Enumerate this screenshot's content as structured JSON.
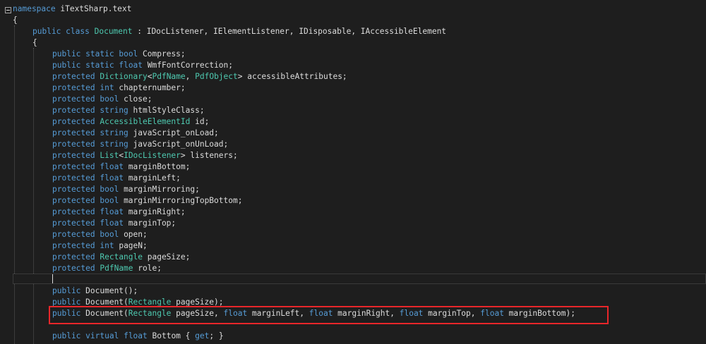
{
  "editor": {
    "lines": [
      [
        {
          "t": "namespace",
          "c": "kw"
        },
        {
          "t": " iTextSharp.text",
          "c": "id"
        }
      ],
      [
        {
          "t": "{",
          "c": "id"
        }
      ],
      [
        {
          "t": "public",
          "c": "kw"
        },
        {
          "t": " ",
          "c": "id"
        },
        {
          "t": "class",
          "c": "kw"
        },
        {
          "t": " ",
          "c": "id"
        },
        {
          "t": "Document",
          "c": "ty"
        },
        {
          "t": " : IDocListener, IElementListener, IDisposable, IAccessibleElement",
          "c": "id"
        }
      ],
      [
        {
          "t": "{",
          "c": "id"
        }
      ],
      [
        {
          "t": "public",
          "c": "kw"
        },
        {
          "t": " ",
          "c": "id"
        },
        {
          "t": "static",
          "c": "kw"
        },
        {
          "t": " ",
          "c": "id"
        },
        {
          "t": "bool",
          "c": "kw"
        },
        {
          "t": " Compress;",
          "c": "id"
        }
      ],
      [
        {
          "t": "public",
          "c": "kw"
        },
        {
          "t": " ",
          "c": "id"
        },
        {
          "t": "static",
          "c": "kw"
        },
        {
          "t": " ",
          "c": "id"
        },
        {
          "t": "float",
          "c": "kw"
        },
        {
          "t": " WmfFontCorrection;",
          "c": "id"
        }
      ],
      [
        {
          "t": "protected",
          "c": "kw"
        },
        {
          "t": " ",
          "c": "id"
        },
        {
          "t": "Dictionary",
          "c": "ty"
        },
        {
          "t": "<",
          "c": "id"
        },
        {
          "t": "PdfName",
          "c": "ty"
        },
        {
          "t": ", ",
          "c": "id"
        },
        {
          "t": "PdfObject",
          "c": "ty"
        },
        {
          "t": "> accessibleAttributes;",
          "c": "id"
        }
      ],
      [
        {
          "t": "protected",
          "c": "kw"
        },
        {
          "t": " ",
          "c": "id"
        },
        {
          "t": "int",
          "c": "kw"
        },
        {
          "t": " chapternumber;",
          "c": "id"
        }
      ],
      [
        {
          "t": "protected",
          "c": "kw"
        },
        {
          "t": " ",
          "c": "id"
        },
        {
          "t": "bool",
          "c": "kw"
        },
        {
          "t": " close;",
          "c": "id"
        }
      ],
      [
        {
          "t": "protected",
          "c": "kw"
        },
        {
          "t": " ",
          "c": "id"
        },
        {
          "t": "string",
          "c": "kw"
        },
        {
          "t": " htmlStyleClass;",
          "c": "id"
        }
      ],
      [
        {
          "t": "protected",
          "c": "kw"
        },
        {
          "t": " ",
          "c": "id"
        },
        {
          "t": "AccessibleElementId",
          "c": "ty"
        },
        {
          "t": " id;",
          "c": "id"
        }
      ],
      [
        {
          "t": "protected",
          "c": "kw"
        },
        {
          "t": " ",
          "c": "id"
        },
        {
          "t": "string",
          "c": "kw"
        },
        {
          "t": " javaScript_onLoad;",
          "c": "id"
        }
      ],
      [
        {
          "t": "protected",
          "c": "kw"
        },
        {
          "t": " ",
          "c": "id"
        },
        {
          "t": "string",
          "c": "kw"
        },
        {
          "t": " javaScript_onUnLoad;",
          "c": "id"
        }
      ],
      [
        {
          "t": "protected",
          "c": "kw"
        },
        {
          "t": " ",
          "c": "id"
        },
        {
          "t": "List",
          "c": "ty"
        },
        {
          "t": "<",
          "c": "id"
        },
        {
          "t": "IDocListener",
          "c": "ty"
        },
        {
          "t": "> listeners;",
          "c": "id"
        }
      ],
      [
        {
          "t": "protected",
          "c": "kw"
        },
        {
          "t": " ",
          "c": "id"
        },
        {
          "t": "float",
          "c": "kw"
        },
        {
          "t": " marginBottom;",
          "c": "id"
        }
      ],
      [
        {
          "t": "protected",
          "c": "kw"
        },
        {
          "t": " ",
          "c": "id"
        },
        {
          "t": "float",
          "c": "kw"
        },
        {
          "t": " marginLeft;",
          "c": "id"
        }
      ],
      [
        {
          "t": "protected",
          "c": "kw"
        },
        {
          "t": " ",
          "c": "id"
        },
        {
          "t": "bool",
          "c": "kw"
        },
        {
          "t": " marginMirroring;",
          "c": "id"
        }
      ],
      [
        {
          "t": "protected",
          "c": "kw"
        },
        {
          "t": " ",
          "c": "id"
        },
        {
          "t": "bool",
          "c": "kw"
        },
        {
          "t": " marginMirroringTopBottom;",
          "c": "id"
        }
      ],
      [
        {
          "t": "protected",
          "c": "kw"
        },
        {
          "t": " ",
          "c": "id"
        },
        {
          "t": "float",
          "c": "kw"
        },
        {
          "t": " marginRight;",
          "c": "id"
        }
      ],
      [
        {
          "t": "protected",
          "c": "kw"
        },
        {
          "t": " ",
          "c": "id"
        },
        {
          "t": "float",
          "c": "kw"
        },
        {
          "t": " marginTop;",
          "c": "id"
        }
      ],
      [
        {
          "t": "protected",
          "c": "kw"
        },
        {
          "t": " ",
          "c": "id"
        },
        {
          "t": "bool",
          "c": "kw"
        },
        {
          "t": " open;",
          "c": "id"
        }
      ],
      [
        {
          "t": "protected",
          "c": "kw"
        },
        {
          "t": " ",
          "c": "id"
        },
        {
          "t": "int",
          "c": "kw"
        },
        {
          "t": " pageN;",
          "c": "id"
        }
      ],
      [
        {
          "t": "protected",
          "c": "kw"
        },
        {
          "t": " ",
          "c": "id"
        },
        {
          "t": "Rectangle",
          "c": "ty"
        },
        {
          "t": " pageSize;",
          "c": "id"
        }
      ],
      [
        {
          "t": "protected",
          "c": "kw"
        },
        {
          "t": " ",
          "c": "id"
        },
        {
          "t": "PdfName",
          "c": "ty"
        },
        {
          "t": " role;",
          "c": "id"
        }
      ],
      [],
      [
        {
          "t": "public",
          "c": "kw"
        },
        {
          "t": " Document();",
          "c": "id"
        }
      ],
      [
        {
          "t": "public",
          "c": "kw"
        },
        {
          "t": " Document(",
          "c": "id"
        },
        {
          "t": "Rectangle",
          "c": "ty"
        },
        {
          "t": " pageSize);",
          "c": "id"
        }
      ],
      [
        {
          "t": "public",
          "c": "kw"
        },
        {
          "t": " Document(",
          "c": "id"
        },
        {
          "t": "Rectangle",
          "c": "ty"
        },
        {
          "t": " pageSize, ",
          "c": "id"
        },
        {
          "t": "float",
          "c": "kw"
        },
        {
          "t": " marginLeft, ",
          "c": "id"
        },
        {
          "t": "float",
          "c": "kw"
        },
        {
          "t": " marginRight, ",
          "c": "id"
        },
        {
          "t": "float",
          "c": "kw"
        },
        {
          "t": " marginTop, ",
          "c": "id"
        },
        {
          "t": "float",
          "c": "kw"
        },
        {
          "t": " marginBottom);",
          "c": "id"
        }
      ],
      [],
      [
        {
          "t": "public",
          "c": "kw"
        },
        {
          "t": " ",
          "c": "id"
        },
        {
          "t": "virtual",
          "c": "kw"
        },
        {
          "t": " ",
          "c": "id"
        },
        {
          "t": "float",
          "c": "kw"
        },
        {
          "t": " Bottom { ",
          "c": "id"
        },
        {
          "t": "get",
          "c": "kw"
        },
        {
          "t": "; }",
          "c": "id"
        }
      ]
    ]
  },
  "colors": {
    "background": "#1e1e1e",
    "keyword": "#569cd6",
    "type": "#4ec9b0",
    "identifier": "#dcdcdc",
    "highlight_box": "#e8262a"
  },
  "icons": {
    "fold": "collapse-minus-icon"
  }
}
